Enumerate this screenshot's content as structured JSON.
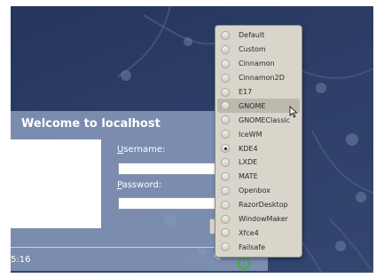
{
  "login": {
    "title": "Welcome to localhost",
    "username_label_u": "U",
    "username_label_rest": "sername:",
    "password_label_u": "P",
    "password_label_rest": "assword:",
    "username_value": "",
    "password_value": "",
    "clock": "5:16"
  },
  "session_menu": {
    "items": [
      {
        "label": "Default",
        "selected": false
      },
      {
        "label": "Custom",
        "selected": false
      },
      {
        "label": "Cinnamon",
        "selected": false
      },
      {
        "label": "Cinnamon2D",
        "selected": false
      },
      {
        "label": "E17",
        "selected": false
      },
      {
        "label": "GNOME",
        "selected": false,
        "hovered": true
      },
      {
        "label": "GNOMEClassic",
        "selected": false
      },
      {
        "label": "IceWM",
        "selected": false
      },
      {
        "label": "KDE4",
        "selected": true
      },
      {
        "label": "LXDE",
        "selected": false
      },
      {
        "label": "MATE",
        "selected": false
      },
      {
        "label": "Openbox",
        "selected": false
      },
      {
        "label": "RazorDesktop",
        "selected": false
      },
      {
        "label": "WindowMaker",
        "selected": false
      },
      {
        "label": "Xfce4",
        "selected": false
      },
      {
        "label": "Failsafe",
        "selected": false
      }
    ]
  },
  "icons": {
    "session": "session-select-icon",
    "power": "power-icon",
    "cursor": "mouse-pointer-icon"
  },
  "colors": {
    "desktop_bg": "#2d3f68",
    "panel_bg": "#8c9ebe",
    "menu_bg": "#d9d5cb",
    "power_green": "#3bb33b"
  }
}
